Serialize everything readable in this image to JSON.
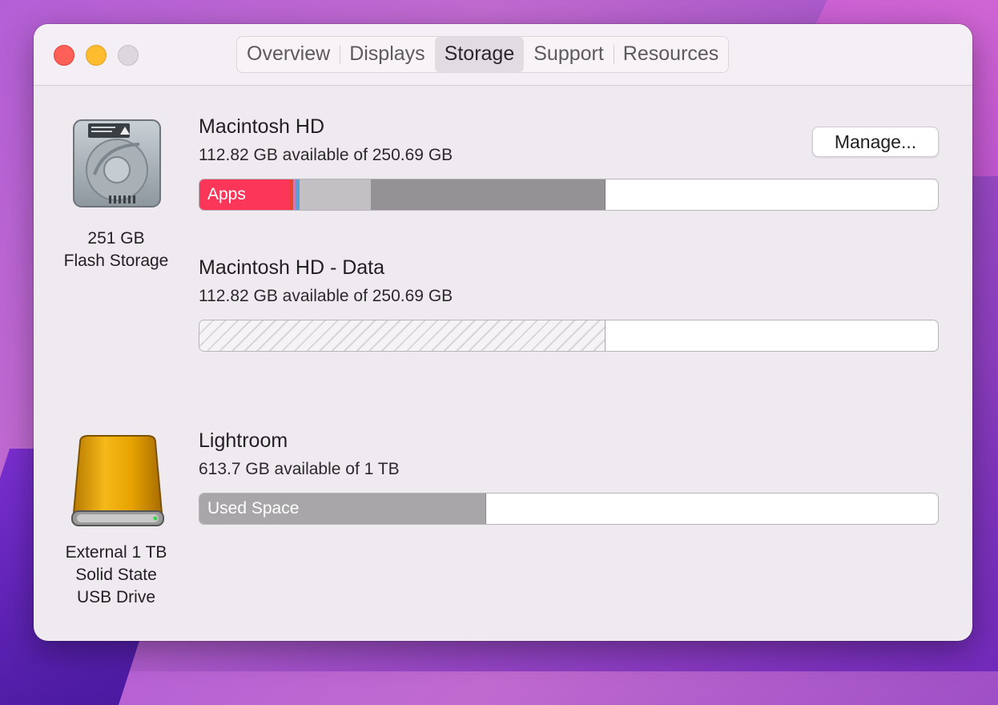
{
  "window": {
    "tabs": [
      {
        "label": "Overview",
        "active": false
      },
      {
        "label": "Displays",
        "active": false
      },
      {
        "label": "Storage",
        "active": true
      },
      {
        "label": "Support",
        "active": false
      },
      {
        "label": "Resources",
        "active": false
      }
    ]
  },
  "devices": {
    "internal": {
      "line1": "251 GB",
      "line2": "Flash Storage",
      "icon": "hard-drive-icon"
    },
    "external": {
      "line1": "External 1 TB",
      "line2": "Solid State",
      "line3": "USB Drive",
      "icon": "external-drive-icon"
    }
  },
  "volumes": [
    {
      "name": "Macintosh HD",
      "availability": "112.82 GB available of 250.69 GB",
      "manage_label": "Manage...",
      "bar_label": "Apps",
      "used_fraction": 0.55
    },
    {
      "name": "Macintosh HD - Data",
      "availability": "112.82 GB available of 250.69 GB",
      "used_fraction": 0.55
    },
    {
      "name": "Lightroom",
      "availability": "613.7 GB available of 1 TB",
      "bar_label": "Used Space",
      "used_fraction": 0.386
    }
  ],
  "colors": {
    "apps": "#fb3659",
    "other_red": "#e8452c",
    "blue": "#5a9fd6",
    "light_gray": "#c2c0c2",
    "dark_gray": "#949294",
    "used_space": "#a8a6a8"
  }
}
